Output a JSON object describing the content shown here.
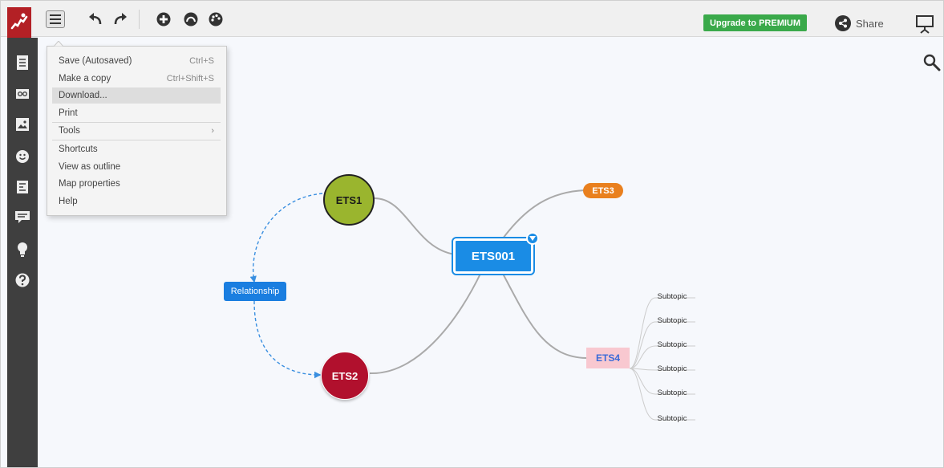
{
  "topbar": {
    "premium_label": "Upgrade to PREMIUM",
    "share_label": "Share",
    "colors": {
      "premium": "#3aa94a",
      "logo": "#b32025"
    },
    "icons": [
      "menu-icon",
      "undo-icon",
      "redo-icon",
      "add-topic-icon",
      "relationship-icon",
      "palette-icon",
      "share-icon",
      "presentation-icon"
    ]
  },
  "menu": {
    "items": [
      {
        "label": "Save (Autosaved)",
        "shortcut": "Ctrl+S"
      },
      {
        "label": "Make a copy",
        "shortcut": "Ctrl+Shift+S"
      },
      {
        "label": "Download...",
        "shortcut": ""
      },
      {
        "label": "Print",
        "shortcut": ""
      },
      {
        "label": "Tools",
        "shortcut": "›"
      },
      {
        "label": "Shortcuts",
        "shortcut": ""
      },
      {
        "label": "View as outline",
        "shortcut": ""
      },
      {
        "label": "Map properties",
        "shortcut": ""
      },
      {
        "label": "Help",
        "shortcut": ""
      }
    ]
  },
  "sidebar": {
    "icons": [
      "document-icon",
      "link-icon",
      "image-icon",
      "emoji-icon",
      "notes-icon",
      "comment-icon",
      "idea-icon",
      "help-icon"
    ]
  },
  "map": {
    "central": "ETS001",
    "topics": {
      "ets1": "ETS1",
      "ets2": "ETS2",
      "ets3": "ETS3",
      "ets4": "ETS4"
    },
    "relationship_label": "Relationship",
    "subtopics": [
      "Subtopic",
      "Subtopic",
      "Subtopic",
      "Subtopic",
      "Subtopic",
      "Subtopic"
    ],
    "colors": {
      "central": "#1a8ce5",
      "ets1": "#9ab52e",
      "ets2": "#b1102d",
      "ets3": "#e9801e",
      "ets4": "#f8c8d0"
    }
  },
  "zoom": {
    "in": "+",
    "out": "−"
  }
}
